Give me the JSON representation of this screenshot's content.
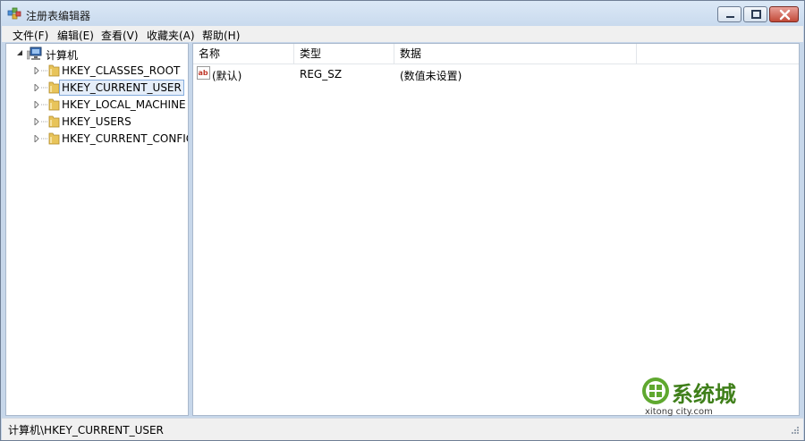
{
  "window": {
    "title": "注册表编辑器",
    "title_icon": "regedit-icon"
  },
  "menu": [
    "文件(F)",
    "编辑(E)",
    "查看(V)",
    "收藏夹(A)",
    "帮助(H)"
  ],
  "tree": {
    "root": {
      "label": "计算机",
      "icon": "computer-icon",
      "expanded": true
    },
    "keys": [
      {
        "label": "HKEY_CLASSES_ROOT",
        "selected": false
      },
      {
        "label": "HKEY_CURRENT_USER",
        "selected": true
      },
      {
        "label": "HKEY_LOCAL_MACHINE",
        "selected": false
      },
      {
        "label": "HKEY_USERS",
        "selected": false
      },
      {
        "label": "HKEY_CURRENT_CONFIG",
        "selected": false
      }
    ]
  },
  "list": {
    "columns": [
      "名称",
      "类型",
      "数据"
    ],
    "rows": [
      {
        "name": "(默认)",
        "type": "REG_SZ",
        "data": "(数值未设置)",
        "icon": "string-value-icon"
      }
    ]
  },
  "status": {
    "path": "计算机\\HKEY_CURRENT_USER"
  },
  "watermark": {
    "text": "系统城",
    "url": "xitong city.com"
  },
  "colors": {
    "selection": "#e5eef9",
    "selection_border": "#84acdd",
    "folder": "#e8c45a",
    "watermark": "#3f7f1a"
  }
}
